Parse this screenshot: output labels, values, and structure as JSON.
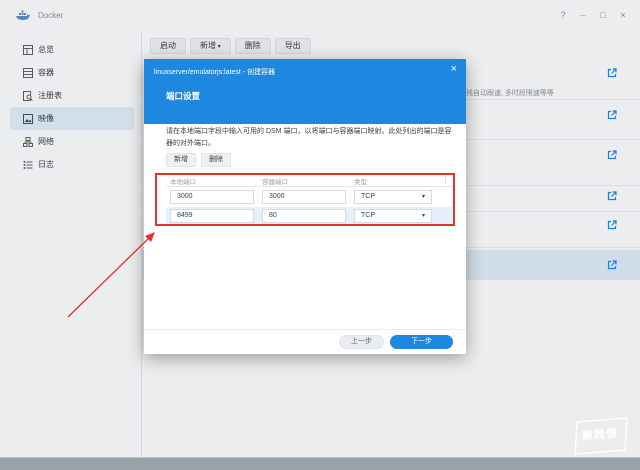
{
  "window": {
    "title": "Docker",
    "controls": [
      "?",
      "–",
      "□",
      "×"
    ]
  },
  "sidebar": {
    "items": [
      {
        "label": "总览",
        "icon": "overview-icon",
        "active": false
      },
      {
        "label": "容器",
        "icon": "container-icon",
        "active": false
      },
      {
        "label": "注册表",
        "icon": "registry-search-icon",
        "active": false
      },
      {
        "label": "映像",
        "icon": "image-icon",
        "active": true
      },
      {
        "label": "网络",
        "icon": "network-icon",
        "active": false
      },
      {
        "label": "日志",
        "icon": "log-list-icon",
        "active": false
      }
    ]
  },
  "toolbar": {
    "launch": "启动",
    "add": "新增",
    "delete": "删除",
    "export": "导出"
  },
  "image_list": {
    "row_fragments": [
      "残自动跟速, 多时段限速等等"
    ]
  },
  "dialog": {
    "title": "linuxserver/emulatorjs:latest - 创建容器",
    "close": "×",
    "subtitle": "端口设置",
    "description": "请在本地端口字段中输入可用的 DSM 端口，以将端口与容器端口映射。此处列出的端口是容器的对外端口。",
    "add_button": "新增",
    "delete_button": "删除",
    "columns": {
      "local_port": "本地端口",
      "container_port": "容器端口",
      "type": "类型",
      "menu": "⋮"
    },
    "ports": [
      {
        "local": "3000",
        "container": "3000",
        "type": "TCP"
      },
      {
        "local": "8499",
        "container": "80",
        "type": "TCP"
      }
    ],
    "prev_button": "上一步",
    "next_button": "下一步"
  },
  "annotation": {
    "highlight_color": "#e2352a",
    "arrow_color": "#e2352a"
  },
  "watermark": {
    "text": "聚超值"
  },
  "colors": {
    "accent": "#1e88e0",
    "selection": "#deebf8"
  }
}
